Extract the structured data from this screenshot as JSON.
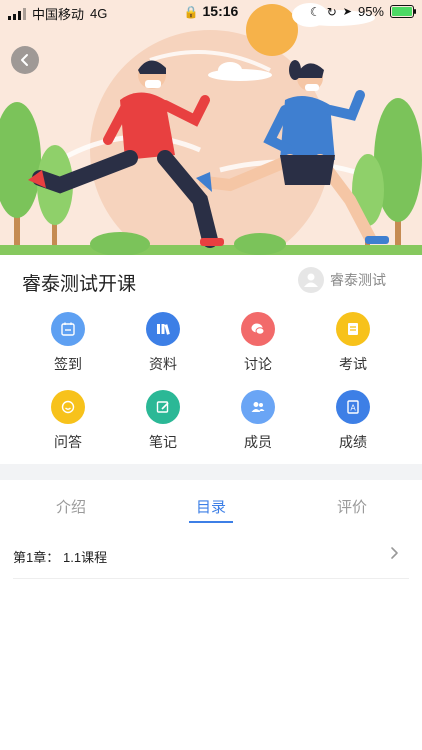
{
  "status_bar": {
    "carrier": "中国移动",
    "network": "4G",
    "time": "15:16",
    "battery": "95%"
  },
  "course": {
    "title": "睿泰测试开课",
    "teacher_name": "睿泰测试"
  },
  "functions": [
    {
      "label": "签到",
      "color": "#5ea0f2",
      "icon": "calendar-icon"
    },
    {
      "label": "资料",
      "color": "#3d7fe6",
      "icon": "books-icon"
    },
    {
      "label": "讨论",
      "color": "#f26a6a",
      "icon": "chat-icon"
    },
    {
      "label": "考试",
      "color": "#f7c21b",
      "icon": "exam-paper-icon"
    },
    {
      "label": "问答",
      "color": "#f7c21b",
      "icon": "qa-bubble-icon"
    },
    {
      "label": "笔记",
      "color": "#2bb896",
      "icon": "note-edit-icon"
    },
    {
      "label": "成员",
      "color": "#6aa5f5",
      "icon": "members-icon"
    },
    {
      "label": "成绩",
      "color": "#3d7fe6",
      "icon": "grade-doc-icon"
    }
  ],
  "tabs": [
    {
      "label": "介绍"
    },
    {
      "label": "目录"
    },
    {
      "label": "评价"
    }
  ],
  "active_tab": "目录",
  "chapters": [
    {
      "label": "第1章：",
      "title": "1.1课程"
    }
  ]
}
